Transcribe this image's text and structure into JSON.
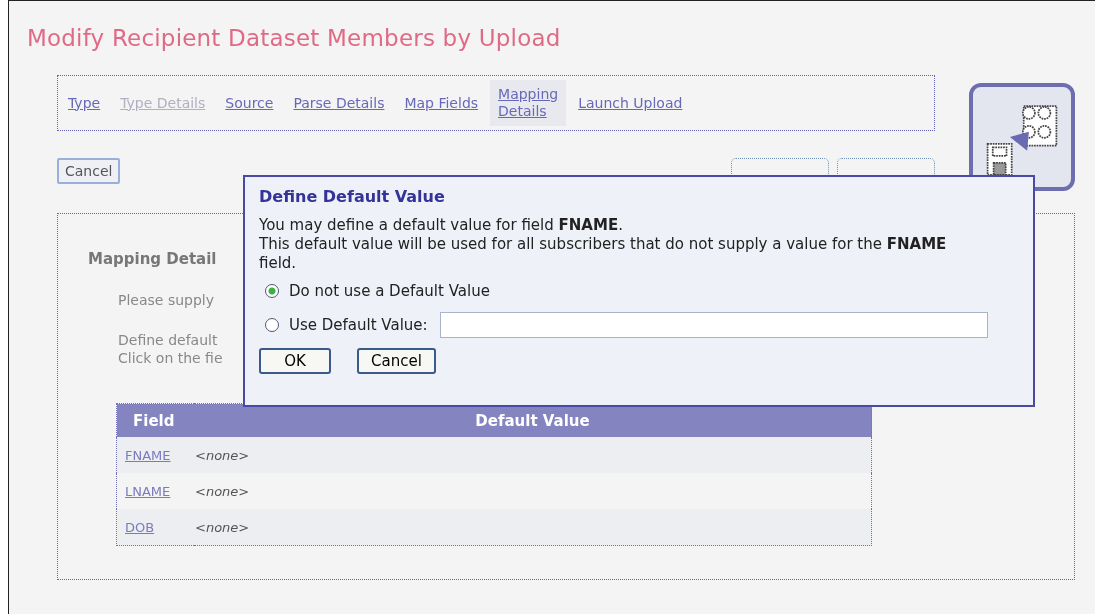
{
  "page_title": "Modify Recipient Dataset Members by Upload",
  "steps": [
    {
      "label": "Type",
      "selected": false,
      "disabled": false
    },
    {
      "label": "Type Details",
      "selected": false,
      "disabled": true
    },
    {
      "label": "Source",
      "selected": false,
      "disabled": false
    },
    {
      "label": "Parse Details",
      "selected": false,
      "disabled": false
    },
    {
      "label": "Map Fields",
      "selected": false,
      "disabled": false
    },
    {
      "label": "Mapping Details",
      "selected": true,
      "disabled": false
    },
    {
      "label": "Launch Upload",
      "selected": false,
      "disabled": false
    }
  ],
  "cancel_button": "Cancel",
  "section": {
    "heading": "Mapping Detail",
    "line_1": "Please supply",
    "line_2": "Define default",
    "line_3": "Click on the fie"
  },
  "table": {
    "columns": [
      "Field",
      "Default Value"
    ],
    "rows": [
      {
        "field": "FNAME",
        "value": "<none>"
      },
      {
        "field": "LNAME",
        "value": "<none>"
      },
      {
        "field": "DOB",
        "value": "<none>"
      }
    ]
  },
  "dialog": {
    "title": "Define Default Value",
    "message": "You may define a default value for field **FNAME**.\nThis default value will be used for all subscribers that do not supply a value for the **FNAME** field.",
    "options": [
      {
        "label": "Do not use a Default Value",
        "selected": true,
        "kind": "plain"
      },
      {
        "label": "Use Default Value:",
        "selected": false,
        "kind": "input"
      }
    ],
    "buttons": [
      "OK",
      "Cancel"
    ]
  }
}
